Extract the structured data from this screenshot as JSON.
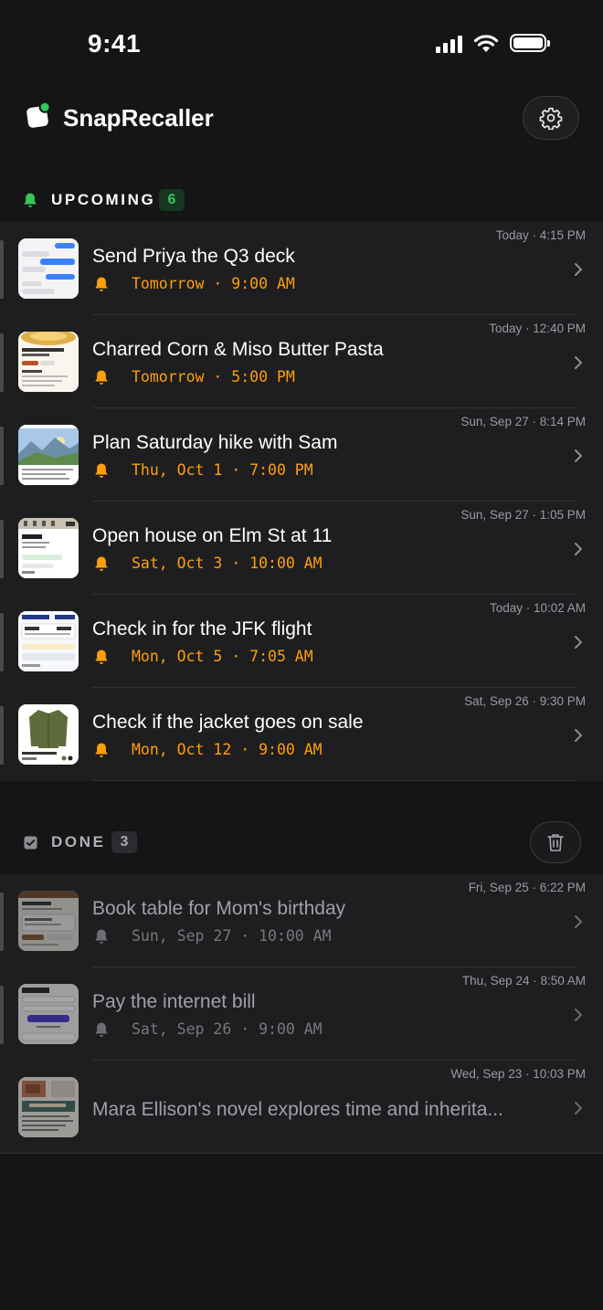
{
  "status_bar": {
    "time": "9:41"
  },
  "header": {
    "app_name": "SnapRecaller",
    "settings_icon": "gear-icon"
  },
  "upcoming": {
    "label": "UPCOMING",
    "count": "6",
    "accent": "#34c759",
    "items": [
      {
        "title": "Send Priya the Q3 deck",
        "reminder": "Tomorrow · 9:00 AM",
        "captured": "Today · 4:15 PM",
        "thumbnail": "messages-screenshot"
      },
      {
        "title": "Charred Corn & Miso Butter Pasta",
        "reminder": "Tomorrow · 5:00 PM",
        "captured": "Today · 12:40 PM",
        "thumbnail": "recipe-screenshot"
      },
      {
        "title": "Plan Saturday hike with Sam",
        "reminder": "Thu, Oct 1 · 7:00 PM",
        "captured": "Sun, Sep 27 · 8:14 PM",
        "thumbnail": "mountain-trail-screenshot"
      },
      {
        "title": "Open house on Elm St at 11",
        "reminder": "Sat, Oct 3 · 10:00 AM",
        "captured": "Sun, Sep 27 · 1:05 PM",
        "thumbnail": "real-estate-listing-screenshot"
      },
      {
        "title": "Check in for the JFK flight",
        "reminder": "Mon, Oct 5 · 7:05 AM",
        "captured": "Today · 10:02 AM",
        "thumbnail": "flight-booking-screenshot"
      },
      {
        "title": "Check if the jacket goes on sale",
        "reminder": "Mon, Oct 12 · 9:00 AM",
        "captured": "Sat, Sep 26 · 9:30 PM",
        "thumbnail": "jacket-product-screenshot"
      }
    ]
  },
  "done": {
    "label": "DONE",
    "count": "3",
    "items": [
      {
        "title": "Book table for Mom's birthday",
        "reminder": "Sun, Sep 27 · 10:00 AM",
        "captured": "Fri, Sep 25 · 6:22 PM",
        "thumbnail": "restaurant-reservation-screenshot"
      },
      {
        "title": "Pay the internet bill",
        "reminder": "Sat, Sep 26 · 9:00 AM",
        "captured": "Thu, Sep 24 · 8:50 AM",
        "thumbnail": "bill-payment-screenshot"
      },
      {
        "title": "Mara Ellison's novel explores time and inherita...",
        "captured": "Wed, Sep 23 · 10:03 PM",
        "thumbnail": "book-page-screenshot"
      }
    ]
  },
  "colors": {
    "reminder": "#ff9f0a",
    "background": "#151517",
    "card": "#1e1e21"
  }
}
